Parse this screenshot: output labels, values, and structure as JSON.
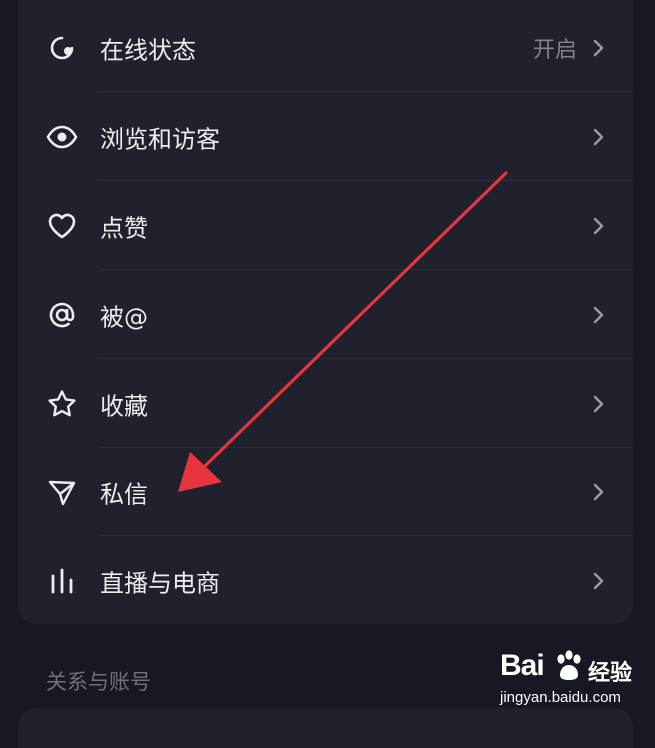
{
  "settings_list": {
    "items": [
      {
        "label": "在线状态",
        "value": "开启",
        "icon": "online-status-icon"
      },
      {
        "label": "浏览和访客",
        "value": "",
        "icon": "eye-icon"
      },
      {
        "label": "点赞",
        "value": "",
        "icon": "heart-icon"
      },
      {
        "label": "被@",
        "value": "",
        "icon": "at-icon"
      },
      {
        "label": "收藏",
        "value": "",
        "icon": "star-icon"
      },
      {
        "label": "私信",
        "value": "",
        "icon": "send-icon"
      },
      {
        "label": "直播与电商",
        "value": "",
        "icon": "bar-chart-icon"
      }
    ]
  },
  "section": {
    "title": "关系与账号"
  },
  "watermark": {
    "brand": "Bai",
    "brand2": "经验",
    "site": "jingyan.baidu.com"
  },
  "colors": {
    "background": "#161823",
    "card": "#1f212c",
    "arrow": "#e8343f",
    "text": "#ecedef",
    "muted": "#80828b"
  }
}
